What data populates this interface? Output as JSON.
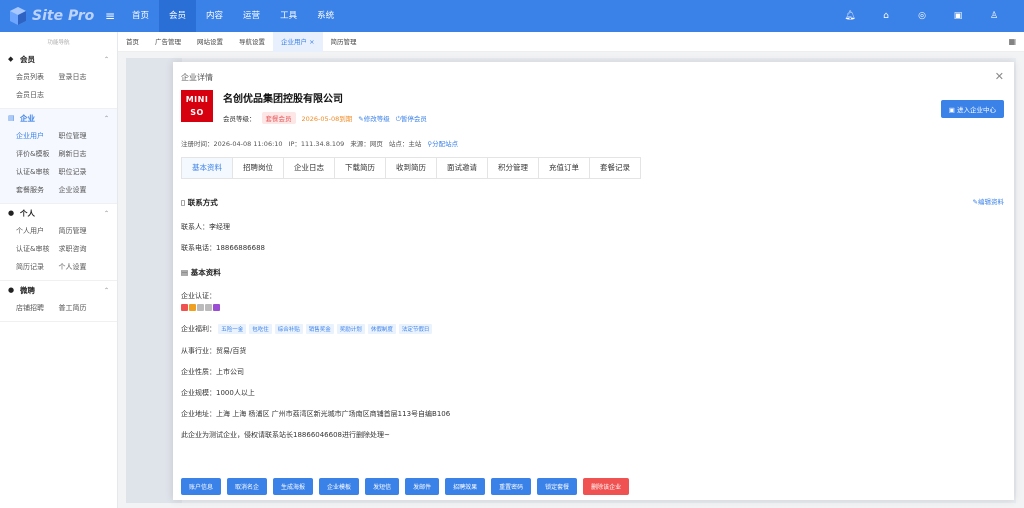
{
  "app": {
    "logo_text": "Site Pro",
    "menu_icon": "hamburger-icon"
  },
  "topnav": [
    {
      "label": "首页"
    },
    {
      "label": "会员"
    },
    {
      "label": "内容"
    },
    {
      "label": "运营"
    },
    {
      "label": "工具"
    },
    {
      "label": "系统"
    }
  ],
  "topicons": [
    "bell-icon",
    "home-icon",
    "compass-icon",
    "toolbox-icon",
    "user-icon"
  ],
  "sidebar": {
    "caption": "功能导航",
    "groups": [
      {
        "label": "会员",
        "icon": "diamond-icon",
        "items": [
          [
            "会员列表",
            "登录日志"
          ],
          [
            "会员日志"
          ]
        ]
      },
      {
        "label": "企业",
        "icon": "building-icon",
        "items": [
          [
            "企业用户",
            "职位管理"
          ],
          [
            "评价&模板",
            "刷新日志"
          ],
          [
            "认证&审核",
            "职位记录"
          ],
          [
            "套餐服务",
            "企业设置"
          ]
        ]
      },
      {
        "label": "个人",
        "icon": "person-icon",
        "items": [
          [
            "个人用户",
            "简历管理"
          ],
          [
            "认证&审核",
            "求职咨询"
          ],
          [
            "简历记录",
            "个人设置"
          ]
        ]
      },
      {
        "label": "微聘",
        "icon": "people-icon",
        "items": [
          [
            "店铺招聘",
            "普工简历"
          ]
        ]
      }
    ]
  },
  "tabs": [
    {
      "label": "首页"
    },
    {
      "label": "广告管理"
    },
    {
      "label": "网站设置"
    },
    {
      "label": "导航设置"
    },
    {
      "label": "企业用户 ×"
    },
    {
      "label": "简历管理"
    }
  ],
  "dialog": {
    "title": "企业详情",
    "brand_logo": "MINI SO",
    "company_name": "名创优品集团控股有限公司",
    "member_level_label": "会员等级：",
    "member_level": "套餐会员",
    "expiry": "2026-05-08到期",
    "modify_level": "修改等级",
    "pause_member": "暂停会员",
    "enter_center": "进入企业中心",
    "reg_time": "注册时间：2026-04-08 11:06:10",
    "ip": "IP：111.34.8.109",
    "source": "来源：网页",
    "site": "站点：主站",
    "assign_site": "分配站点",
    "tabs": [
      "基本资料",
      "招聘岗位",
      "企业日志",
      "下载简历",
      "收到简历",
      "面试邀请",
      "积分管理",
      "充值订单",
      "套餐记录"
    ],
    "contact_title": "联系方式",
    "edit_info": "编辑资料",
    "contact_person": "联系人：李经理",
    "contact_phone": "联系电话：18866886688",
    "basic_title": "基本资料",
    "cert_label": "企业认证：",
    "welfare_label": "企业福利：",
    "welfare_tags": [
      "五险一金",
      "包吃住",
      "综合补贴",
      "销售奖金",
      "奖励计划",
      "休假制度",
      "法定节假日"
    ],
    "industry": "从事行业：贸易/百货",
    "nature": "企业性质：上市公司",
    "scale": "企业规模：1000人以上",
    "address": "企业地址：上海 上海 杨浦区 广州市荔湾区新光城市广场南区商铺首层113号自编B106",
    "note": "此企业为测试企业，侵权请联系站长18866046608进行删除处理~",
    "buttons": [
      "账户信息",
      "取消名企",
      "生成海报",
      "企业模板",
      "发短信",
      "发邮件",
      "招聘效果",
      "重置密码",
      "锁定套餐",
      "删除该企业"
    ]
  }
}
